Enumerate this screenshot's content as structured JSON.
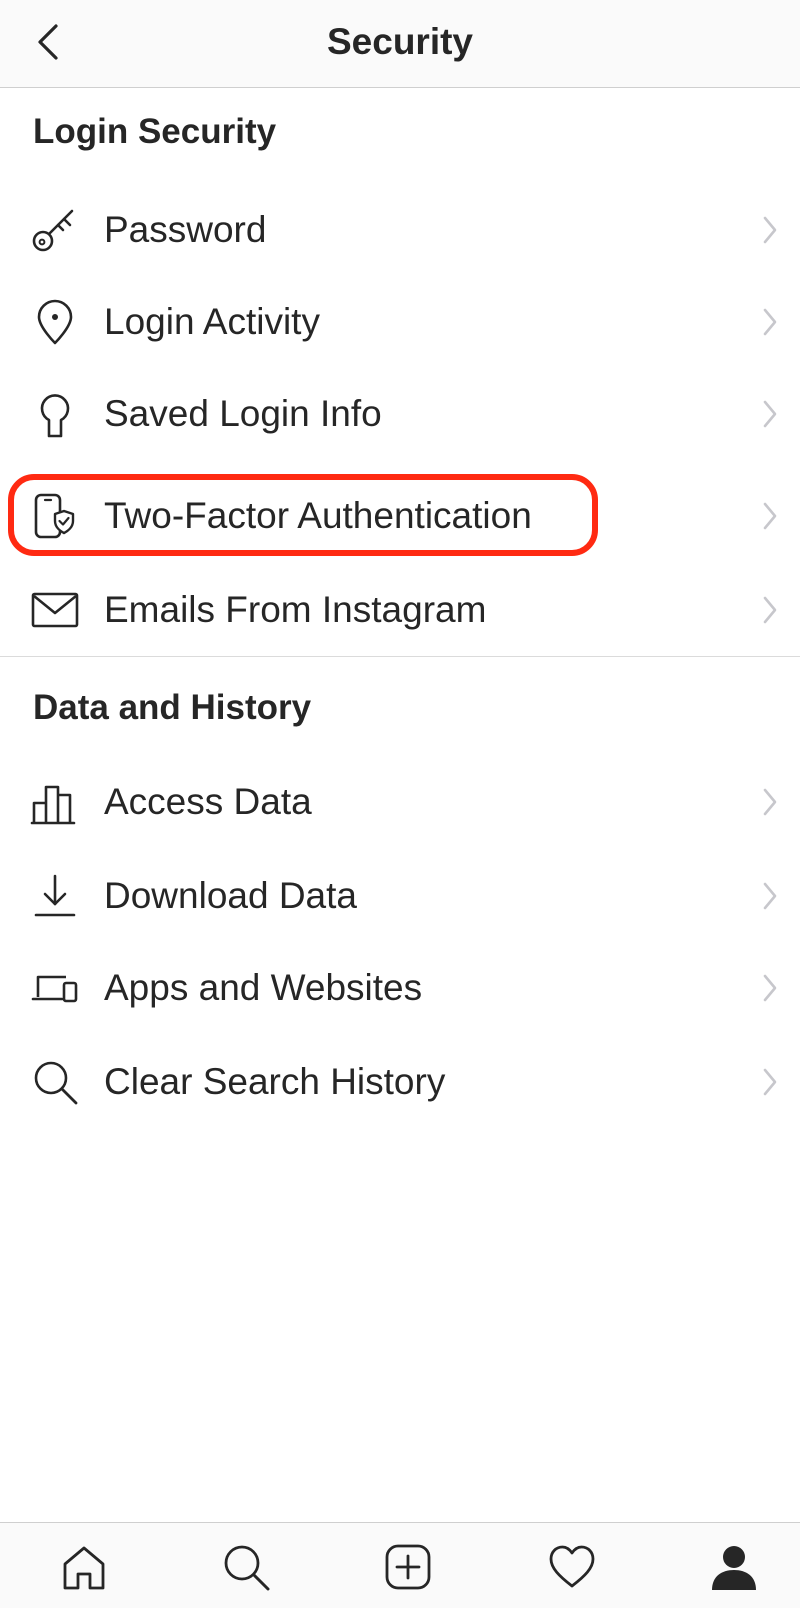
{
  "header": {
    "title": "Security"
  },
  "login_security": {
    "title": "Login Security",
    "items": [
      {
        "label": "Password",
        "icon": "key-icon"
      },
      {
        "label": "Login Activity",
        "icon": "location-pin-icon"
      },
      {
        "label": "Saved Login Info",
        "icon": "keyhole-icon"
      },
      {
        "label": "Two-Factor Authentication",
        "icon": "phone-shield-icon"
      },
      {
        "label": "Emails From Instagram",
        "icon": "envelope-icon"
      }
    ]
  },
  "data_history": {
    "title": "Data and History",
    "items": [
      {
        "label": "Access Data",
        "icon": "bar-chart-icon"
      },
      {
        "label": "Download Data",
        "icon": "download-icon"
      },
      {
        "label": "Apps and Websites",
        "icon": "devices-icon"
      },
      {
        "label": "Clear Search History",
        "icon": "search-icon"
      }
    ]
  },
  "tabbar": {
    "tabs": [
      "home-icon",
      "search-icon",
      "new-post-icon",
      "activity-heart-icon",
      "profile-icon"
    ]
  },
  "colors": {
    "highlight": "#ff2a12",
    "text": "#262626",
    "chevron": "#c7c7cc"
  }
}
